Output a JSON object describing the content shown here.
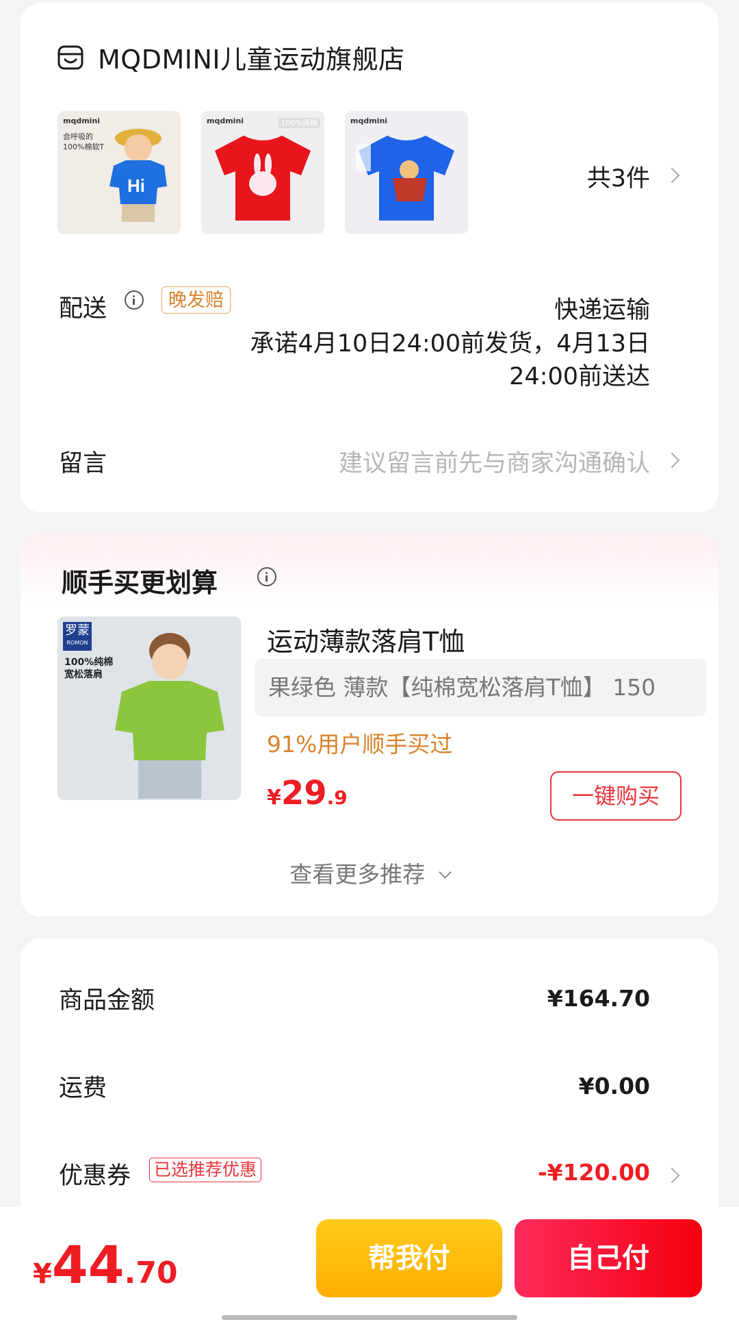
{
  "shop": {
    "name": "MQDMINI儿童运动旗舰店",
    "icon": "store-icon"
  },
  "items": {
    "thumbnails": [
      {
        "brand": "mqdmini",
        "tag": "会呼吸的\n100%棉软T",
        "shirt_color": "#1e6fe0",
        "bg": "#f1ece6"
      },
      {
        "brand": "mqdmini",
        "tag": "100%纯棉",
        "shirt_color": "#e8151c",
        "bg": "#f0eef0"
      },
      {
        "brand": "mqdmini",
        "tag": "",
        "shirt_color": "#1f63e8",
        "bg": "#f0eef2"
      }
    ],
    "count_label": "共3件"
  },
  "delivery": {
    "label": "配送",
    "late_badge": "晚发赔",
    "method": "快递运输",
    "promise": "承诺4月10日24:00前发货，4月13日24:00前送达"
  },
  "note": {
    "label": "留言",
    "placeholder": "建议留言前先与商家沟通确认"
  },
  "recommend": {
    "title": "顺手买更划算",
    "product": {
      "image_brand": "罗蒙",
      "image_brand_en": "ROMON",
      "image_text": "100%纯棉\n宽松落肩",
      "title": "运动薄款落肩T恤",
      "variant": "果绿色 薄款【纯棉宽松落肩T恤】 150",
      "social_proof": "91%用户顺手买过",
      "price_currency": "¥",
      "price_int": "29",
      "price_dec": ".9",
      "buy_label": "一键购买",
      "shirt_color": "#8cc63f"
    },
    "see_more": "查看更多推荐"
  },
  "fees": {
    "goods_label": "商品金额",
    "goods_value": "¥164.70",
    "shipping_label": "运费",
    "shipping_value": "¥0.00",
    "coupon_label": "优惠券",
    "coupon_badge": "已选推荐优惠",
    "coupon_value": "-¥120.00"
  },
  "footer": {
    "currency": "¥",
    "total_int": "44",
    "total_dec": ".70",
    "helper_pay": "帮我付",
    "self_pay": "自己付"
  },
  "colors": {
    "accent_red": "#ee1d24",
    "orange": "#d9822b",
    "yellow_btn": "#ffb800"
  }
}
